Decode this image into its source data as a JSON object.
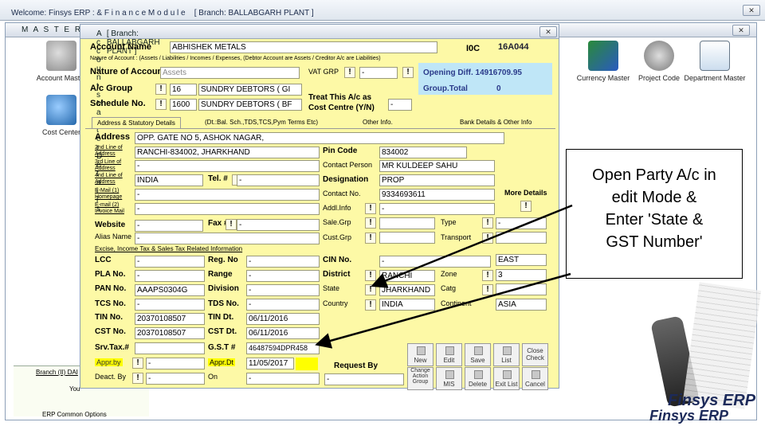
{
  "main_window": {
    "title": "Welcome: Finsys ERP : & F i n a n c e  M o d u l e",
    "branch": "[ Branch: BALLABGARH PLANT ]",
    "close": "✕"
  },
  "master_window": {
    "title": "M A S T E R  F I L",
    "close": "✕"
  },
  "master_icons": [
    {
      "label": "Account Master"
    },
    {
      "label": "Cost Center"
    },
    {
      "label": "Currency Master"
    },
    {
      "label": "Project Code"
    },
    {
      "label": "Department Master"
    }
  ],
  "dialog": {
    "title": "A c c o u n t s  M a s t e r  D e t a i l s",
    "branch": "[ Branch: BALLABGARH PLANT ]",
    "close": "✕",
    "account_name_label": "Account Name",
    "account_name": "ABHISHEK METALS",
    "code_label": "I0C",
    "code_value": "16A044",
    "nature_note": "Nature of Account : (Assets / Liabilities / Incomes / Expenses, (Debtor Account are Assets / Creditor A/c are Liabilities)",
    "nature_label": "Nature of Account",
    "nature_value": "Assets",
    "vat_label": "VAT GRP",
    "vat_value": "-",
    "opening_label": "Opening Diff. 14916709.95",
    "group_total_label": "Group.Total",
    "group_total_value": "0",
    "group_label": "A/c Group",
    "group_code": "16",
    "group_name": "SUNDRY DEBTORS ( GI",
    "schedule_label": "Schedule No.",
    "schedule_code": "1600",
    "schedule_name": "SUNDRY DEBTORS ( BF",
    "treat_label": "Treat This A/c as",
    "cost_label": "Cost Centre (Y/N)",
    "cost_value": "-",
    "tabs": [
      "Address & Statutory Details",
      "(Dt.:Bal. Sch.,TDS,TCS,Pym Terms Etc)",
      "Other Info.",
      "Bank Details & Other Info"
    ],
    "address_label": "Address",
    "address1": "OPP. GATE NO 5, ASHOK NAGAR,",
    "addr2_label": "2nd Line of Address",
    "address2": "RANCHI-834002, JHARKHAND",
    "addr3_label": "3rd Line of Address",
    "address3": "-",
    "addr4_label": "4nd Line of Address",
    "address4": "INDIA",
    "email1_label": "E-Mail (1) Homepage",
    "email1": "-",
    "email2_label": "E-mail (2) Invoice Mail",
    "email2": "-",
    "website_label": "Website",
    "website": "-",
    "alias_label": "Alias Name",
    "alias": "-",
    "pin_label": "Pin Code",
    "pin": "834002",
    "contact_person_label": "Contact Person",
    "contact_person": "MR KULDEEP SAHU",
    "designation_label": "Designation",
    "designation": "PROP",
    "contact_no_label": "Contact No.",
    "contact_no": "9334693611",
    "addl_info_label": "Addl.Info",
    "addl_info": "-",
    "more_details": "More Details",
    "tel_label": "Tel. #",
    "tel": "-",
    "fax_label": "Fax #",
    "fax": "-",
    "salegrp_label": "Sale.Grp",
    "salegrp": "",
    "custgrp_label": "Cust.Grp",
    "custgrp": "",
    "type_label": "Type",
    "type": "-",
    "transport_label": "Transport",
    "transport": "",
    "excise_heading": "Excise, Income Tax & Sales Tax Related Information",
    "lcc_label": "LCC",
    "lcc": "-",
    "pla_label": "PLA No.",
    "pla": "-",
    "pan_label": "PAN No.",
    "pan": "AAAPS0304G",
    "tcs_label": "TCS No.",
    "tcs": "-",
    "tin_label": "TIN No.",
    "tin": "20370108507",
    "cst_label": "CST No.",
    "cst": "20370108507",
    "srvtax_label": "Srv.Tax.#",
    "srvtax": "",
    "regno_label": "Reg. No",
    "regno": "-",
    "range_label": "Range",
    "range": "-",
    "division_label": "Division",
    "division": "-",
    "tds_label": "TDS No.",
    "tds": "-",
    "tindt_label": "TIN Dt.",
    "tindt": "06/11/2016",
    "cstdt_label": "CST Dt.",
    "cstdt": "06/11/2016",
    "gst_label": "G.S.T #",
    "gst": "46487594DPR458",
    "cin_label": "CIN No.",
    "cin": "-",
    "district_label": "District",
    "district": "RANCHI",
    "state_label": "State",
    "state": "JHARKHAND",
    "country_label": "Country",
    "country": "INDIA",
    "zone_label": "Zone",
    "zone": "3",
    "catg_label": "Catg",
    "catg": "",
    "continent_label": "Continent",
    "continent": "ASIA",
    "east": "EAST",
    "approve_label": "Appr.by",
    "approve": "-",
    "appr_dt_label": "Appr.Dt",
    "appr_dt": "11/05/2017",
    "deact_label": "Deact. By",
    "deact": "-",
    "on_label": "On",
    "on_value": "-",
    "request_label": "Request By",
    "request": "-",
    "buttons": [
      "New",
      "Edit",
      "Save",
      "List",
      "Close Check",
      "Change Action Group",
      "MIS",
      "Delete",
      "Exit List",
      "Cancel"
    ]
  },
  "bottom_left": {
    "branch_label": "Branch (II) DAI",
    "you_label": "You",
    "erp_options": "ERP Common Options"
  },
  "callout": {
    "lines": [
      "Open Party A/c in",
      "edit Mode &",
      "Enter 'State &",
      "GST Number'"
    ]
  },
  "brand": "Finsys ERP"
}
